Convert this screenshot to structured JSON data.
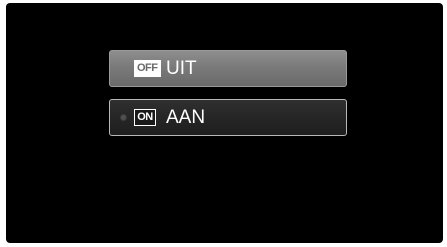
{
  "menu": {
    "options": [
      {
        "icon_text": "OFF",
        "icon_name": "off-icon",
        "label": "UIT",
        "selected": false
      },
      {
        "icon_text": "ON",
        "icon_name": "on-icon",
        "label": "AAN",
        "selected": true
      }
    ]
  },
  "colors": {
    "screen_background": "#000000",
    "off_option_background": "#7a7a7a",
    "on_option_background": "#262626",
    "text": "#ffffff"
  }
}
